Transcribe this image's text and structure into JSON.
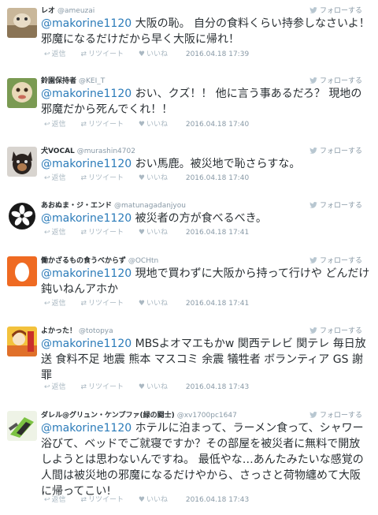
{
  "follow_label": "フォローする",
  "actions": {
    "reply": "返信",
    "retweet": "リツイート",
    "like": "いいね"
  },
  "tweets": [
    {
      "name": "レオ",
      "handle": "@ameuzai",
      "mention": "@makorine1120",
      "body": " 大阪の恥。 自分の食料くらい持参しなさいよ！ 邪魔になるだけだから早く大阪に帰れ！",
      "time": "2016.04.18 17:39"
    },
    {
      "name": "鈴園保持者",
      "handle": "@KEI_T",
      "mention": "@makorine1120",
      "body": " おい、クズ！！ 他に言う事あるだろ？ 現地の邪魔だから死んでくれ！！",
      "time": "2016.04.18 17:40"
    },
    {
      "name": "犬VOCAL",
      "handle": "@murashin4702",
      "mention": "@makorine1120",
      "body": " おい馬鹿。被災地で恥さらすな。",
      "time": "2016.04.18 17:40"
    },
    {
      "name": "あおぬま・ジ・エンド",
      "handle": "@matunagadanjyou",
      "mention": "@makorine1120",
      "body": " 被災者の方が食べるべき。",
      "time": "2016.04.18 17:41"
    },
    {
      "name": "働かざるもの食うべからず",
      "handle": "@OCHtn",
      "mention": "@makorine1120",
      "body": " 現地で買わずに大阪から持って行けや どんだけ鈍いねんアホか",
      "time": "2016.04.18 17:41"
    },
    {
      "name": "よかった！",
      "handle": "@totopya",
      "mention": "@makorine1120",
      "body": " MBSよオマエもかw 関西テレビ 関テレ 毎日放送 食料不足 地震 熊本 マスコミ 余震 犠牲者 ボランティア GS 謝罪",
      "time": "2016.04.18 17:43"
    },
    {
      "name": "ダレル@グリュン・ケンプファ(緑の闘士)",
      "handle": "@xv1700pc1647",
      "mention": "@makorine1120",
      "body": " ホテルに泊まって、ラーメン食って、シャワー浴びて、ベッドでご就寝ですか？その部屋を被災者に無料で開放しようとは思わないんですね。 最低やな…あんたみたいな感覚の人間は被災地の邪魔になるだけやから、さっさと荷物纏めて大阪に帰ってこい!",
      "time": "2016.04.18 17:43"
    }
  ]
}
